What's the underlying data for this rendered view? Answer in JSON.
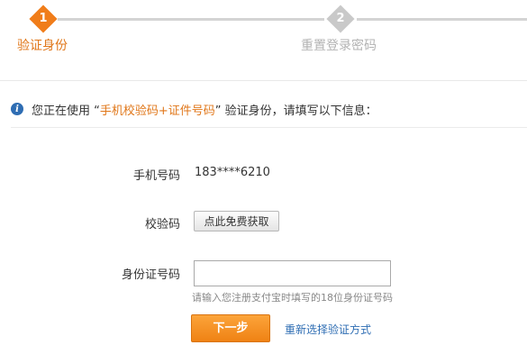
{
  "steps": [
    {
      "number": "1",
      "label": "验证身份",
      "active": true
    },
    {
      "number": "2",
      "label": "重置登录密码",
      "active": false
    }
  ],
  "info": {
    "icon": "info-icon",
    "prefix": "您正在使用 “",
    "highlight": "手机校验码+证件号码",
    "suffix": "” 验证身份，请填写以下信息："
  },
  "form": {
    "phone_label": "手机号码",
    "phone_value": "183****6210",
    "code_label": "校验码",
    "code_button": "点此免费获取",
    "id_label": "身份证号码",
    "id_value": "",
    "id_hint": "请输入您注册支付宝时填写的18位身份证号码"
  },
  "actions": {
    "next_button": "下一步",
    "reselect_link": "重新选择验证方式"
  },
  "colors": {
    "accent": "#f07d1a",
    "link": "#2e6db3",
    "inactive": "#c9c9c9"
  }
}
